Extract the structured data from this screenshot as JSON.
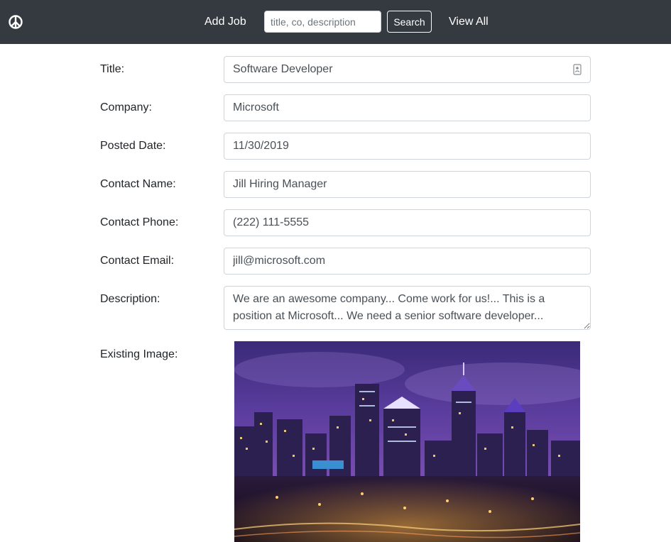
{
  "navbar": {
    "brand_icon": "peace-sign-icon",
    "add_job_label": "Add Job",
    "search_placeholder": "title, co, description",
    "search_button_label": "Search",
    "view_all_label": "View All"
  },
  "form": {
    "title": {
      "label": "Title:",
      "value": "Software Developer"
    },
    "company": {
      "label": "Company:",
      "value": "Microsoft"
    },
    "posted_date": {
      "label": "Posted Date:",
      "value": "11/30/2019"
    },
    "contact_name": {
      "label": "Contact Name:",
      "value": "Jill Hiring Manager"
    },
    "contact_phone": {
      "label": "Contact Phone:",
      "value": "(222) 111-5555"
    },
    "contact_email": {
      "label": "Contact Email:",
      "value": "jill@microsoft.com"
    },
    "description": {
      "label": "Description:",
      "value": "We are an awesome company... Come work for us!... This is a position at Microsoft... We need a senior software developer..."
    },
    "existing_image": {
      "label": "Existing Image:",
      "alt_subject": "city skyline at night"
    }
  },
  "colors": {
    "navbar_bg": "#343a40",
    "border": "#ced4da"
  }
}
